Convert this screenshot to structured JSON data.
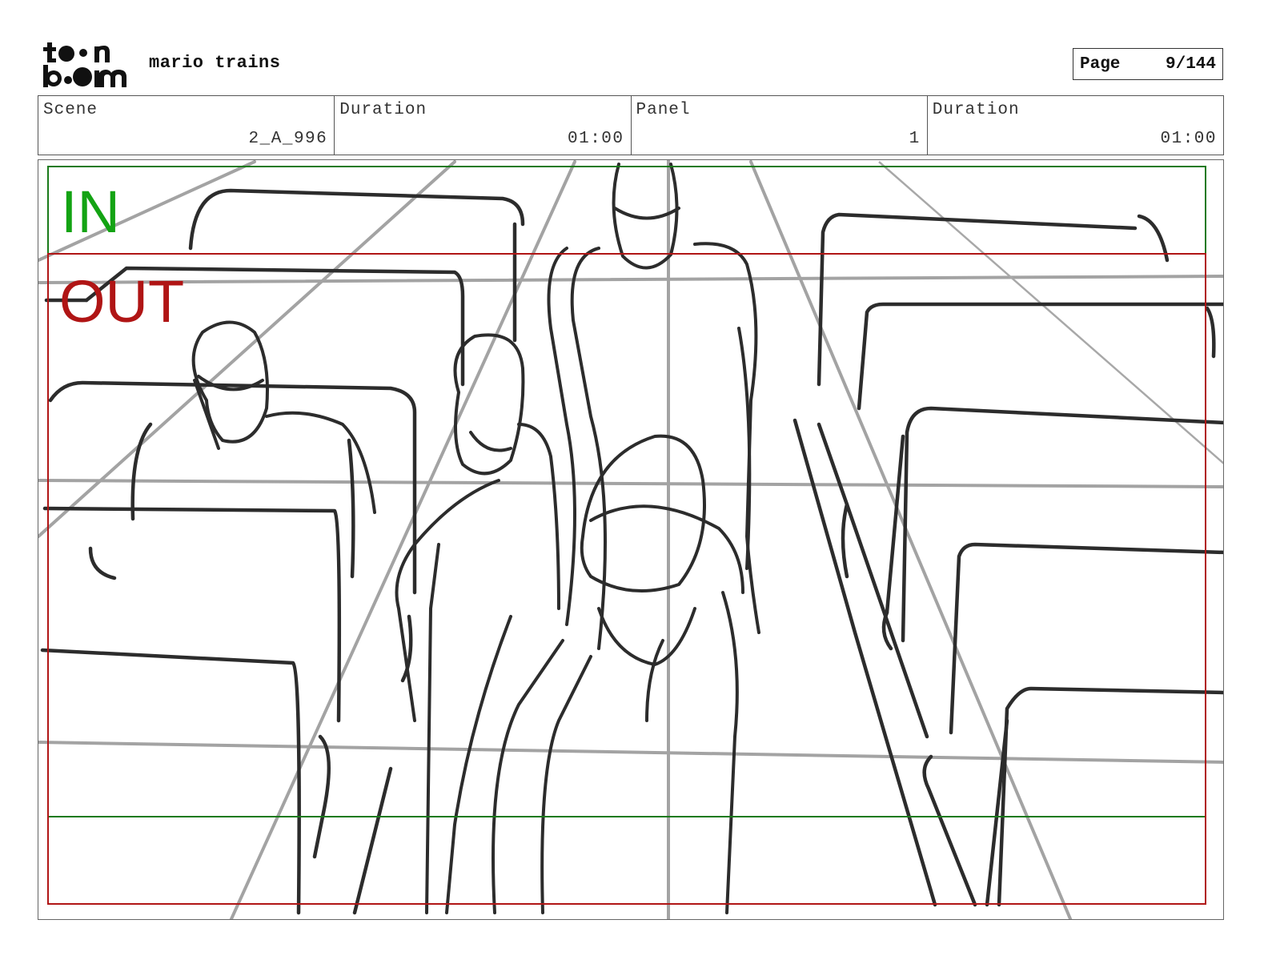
{
  "header": {
    "logo_top": "toon",
    "logo_bottom": "boom",
    "project_title": "mario trains",
    "page_label": "Page",
    "page_number": "9/144"
  },
  "info": {
    "scene_label": "Scene",
    "scene_value": "2_A_996",
    "scene_duration_label": "Duration",
    "scene_duration_value": "01:00",
    "panel_label": "Panel",
    "panel_value": "1",
    "panel_duration_label": "Duration",
    "panel_duration_value": "01:00"
  },
  "panel": {
    "in_label": "IN",
    "out_label": "OUT",
    "colors": {
      "in_frame": "#1a7a1a",
      "out_frame": "#b01515",
      "sketch_dark": "#2a2a2a",
      "sketch_guides": "#9a9a9a"
    }
  }
}
